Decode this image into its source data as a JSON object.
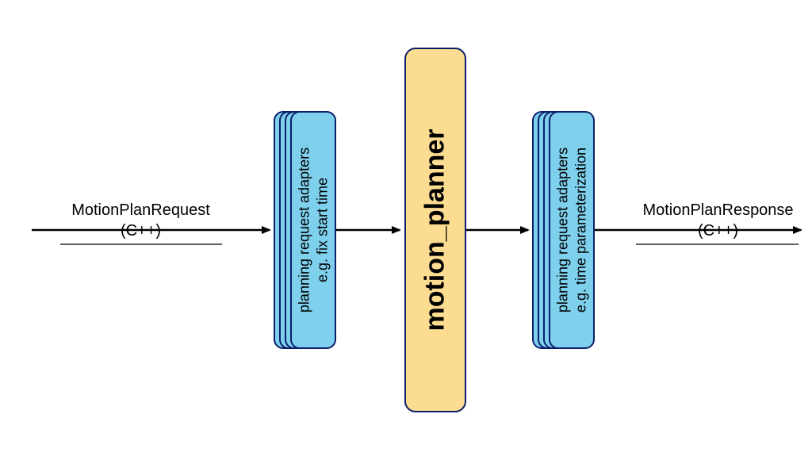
{
  "arrows": {
    "in_label_top": "MotionPlanRequest",
    "in_label_bottom": "(C++)",
    "out_label_top": "MotionPlanResponse",
    "out_label_bottom": "(C++)"
  },
  "adapters_left": {
    "line1": "planning request adapters",
    "line2": "e.g. fix start time"
  },
  "planner": {
    "label": "motion_planner"
  },
  "adapters_right": {
    "line1": "planning request adapters",
    "line2": "e.g. time parameterization"
  },
  "colors": {
    "adapter_fill": "#7ed0ed",
    "planner_fill": "#fbdc91",
    "border": "#0a1f6b"
  }
}
